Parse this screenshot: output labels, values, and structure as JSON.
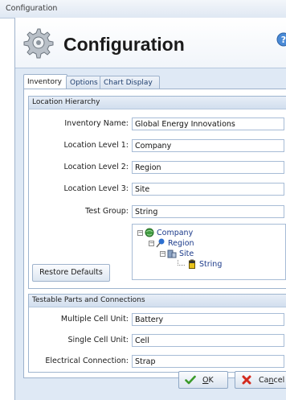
{
  "window": {
    "title": "Configuration"
  },
  "header": {
    "title": "Configuration",
    "icon": "gear-icon",
    "help_icon": "help-icon"
  },
  "tabs": [
    {
      "label": "Inventory",
      "active": true
    },
    {
      "label": "Options",
      "active": false
    },
    {
      "label": "Chart Display",
      "active": false
    }
  ],
  "location_hierarchy": {
    "title": "Location Hierarchy",
    "fields": [
      {
        "label": "Inventory Name:",
        "value": "Global Energy Innovations"
      },
      {
        "label": "Location Level 1:",
        "value": "Company"
      },
      {
        "label": "Location Level 2:",
        "value": "Region"
      },
      {
        "label": "Location Level 3:",
        "value": "Site"
      },
      {
        "label": "Test Group:",
        "value": "String"
      }
    ],
    "tree": [
      {
        "label": "Company",
        "icon": "globe-icon",
        "expanded": true
      },
      {
        "label": "Region",
        "icon": "pin-icon",
        "expanded": true
      },
      {
        "label": "Site",
        "icon": "building-icon",
        "expanded": true
      },
      {
        "label": "String",
        "icon": "battery-icon",
        "expanded": false
      }
    ],
    "restore_label": "Restore Defaults"
  },
  "testable_parts": {
    "title": "Testable Parts and Connections",
    "fields": [
      {
        "label": "Multiple Cell Unit:",
        "value": "Battery"
      },
      {
        "label": "Single Cell Unit:",
        "value": "Cell"
      },
      {
        "label": "Electrical Connection:",
        "value": "Strap"
      }
    ]
  },
  "buttons": {
    "ok": {
      "label_underlined": "O",
      "label_rest": "K",
      "icon": "checkmark-icon"
    },
    "cancel": {
      "label_start": "Ca",
      "label_underlined": "n",
      "label_rest": "cel",
      "icon": "red-x-icon"
    }
  }
}
